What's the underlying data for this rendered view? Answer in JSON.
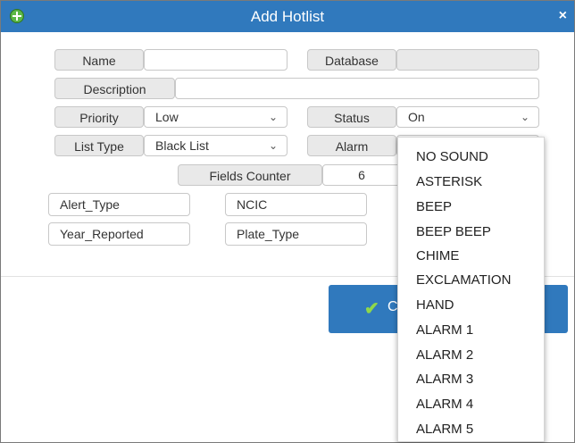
{
  "dialog": {
    "title": "Add Hotlist",
    "close_label": "×"
  },
  "form": {
    "name_label": "Name",
    "name_value": "",
    "database_label": "Database",
    "database_value": "",
    "description_label": "Description",
    "description_value": "",
    "priority_label": "Priority",
    "priority_value": "Low",
    "status_label": "Status",
    "status_value": "On",
    "list_type_label": "List Type",
    "list_type_value": "Black List",
    "alarm_label": "Alarm",
    "fields_counter_label": "Fields Counter",
    "fields_counter_value": "6"
  },
  "fields": [
    "Alert_Type",
    "NCIC",
    "Year_Reported",
    "Plate_Type"
  ],
  "ok_button": {
    "label": "C"
  },
  "alarm_dropdown": {
    "options": [
      "NO SOUND",
      "ASTERISK",
      "BEEP",
      "BEEP BEEP",
      "CHIME",
      "EXCLAMATION",
      "HAND",
      "ALARM 1",
      "ALARM 2",
      "ALARM 3",
      "ALARM 4",
      "ALARM 5"
    ]
  },
  "icons": {
    "add": "add-circle-icon",
    "close": "close-icon",
    "chevron": "chevron-down-icon",
    "check": "checkmark-icon"
  },
  "colors": {
    "titlebar": "#3079bd",
    "button": "#3079bd",
    "add_icon": "#5bb846",
    "check": "#8fd84b"
  }
}
